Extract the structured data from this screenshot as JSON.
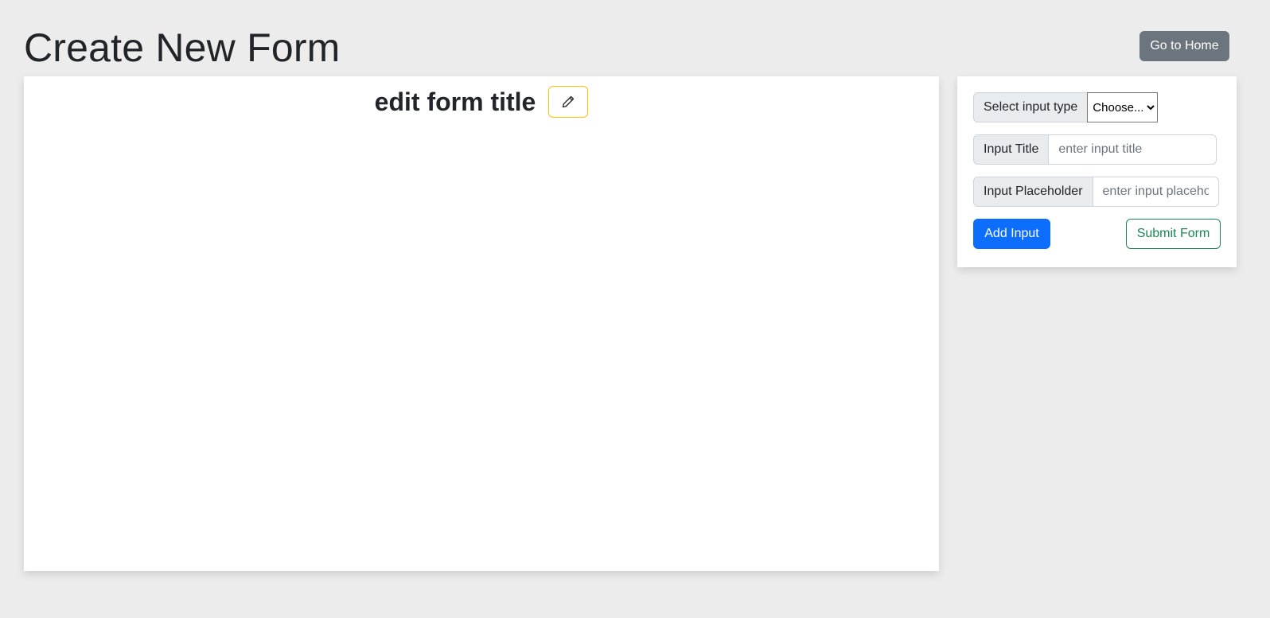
{
  "page": {
    "title": "Create New Form"
  },
  "header": {
    "home_button_label": "Go to Home"
  },
  "form_canvas": {
    "form_title": "edit form title",
    "edit_icon": "pencil-icon"
  },
  "builder": {
    "input_type_label": "Select input type",
    "input_type_options": [
      "Choose..."
    ],
    "input_title_label": "Input Title",
    "input_title_value": "",
    "input_title_placeholder": "enter input title",
    "input_placeholder_label": "Input Placeholder",
    "input_placeholder_value": "",
    "input_placeholder_placeholder": "enter input placeholder",
    "add_input_label": "Add Input",
    "submit_form_label": "Submit Form"
  },
  "colors": {
    "page_background": "#ececec",
    "primary": "#0d6efd",
    "secondary": "#6c757d",
    "success": "#198754",
    "warning": "#ffc107"
  }
}
